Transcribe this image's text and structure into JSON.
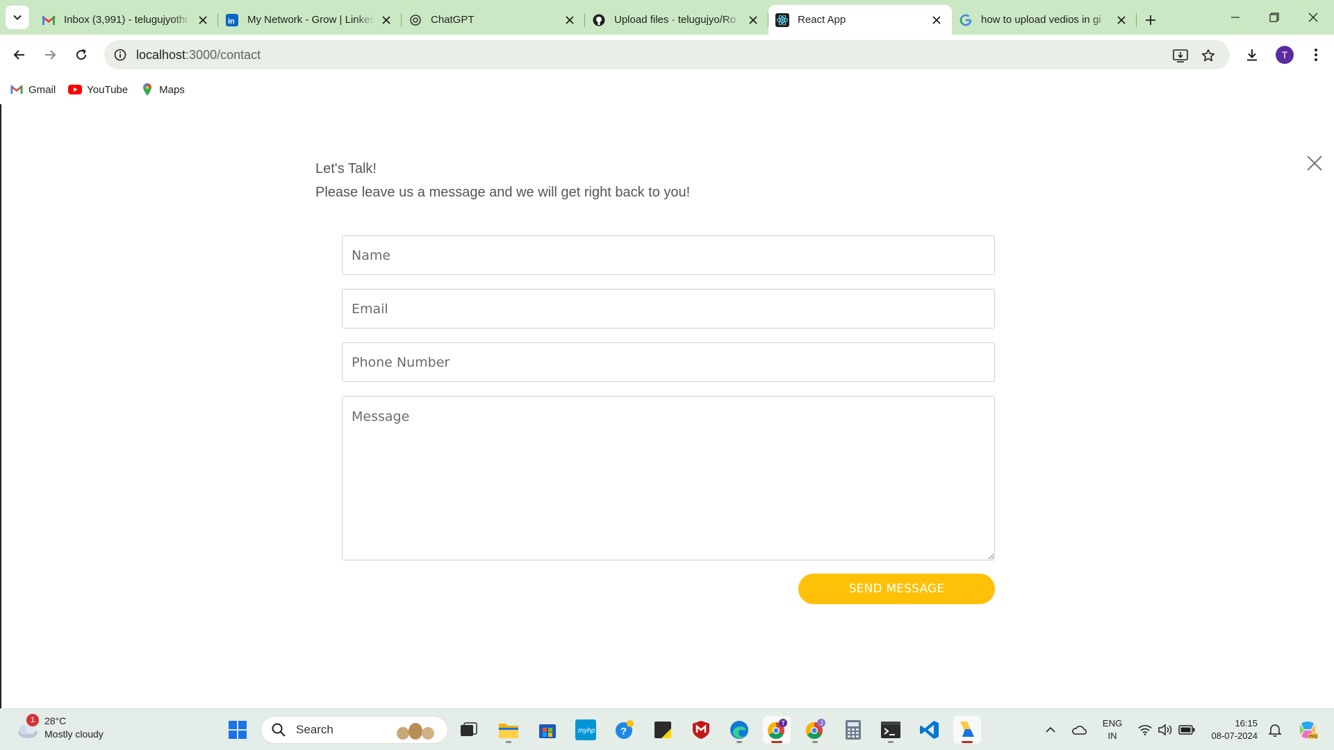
{
  "browser": {
    "tabs": [
      {
        "title": "Inbox (3,991) - telugujyothi",
        "icon": "gmail-icon"
      },
      {
        "title": "My Network - Grow | LinkedIn",
        "icon": "linkedin-icon"
      },
      {
        "title": "ChatGPT",
        "icon": "chatgpt-icon"
      },
      {
        "title": "Upload files · telugujyo/Ro",
        "icon": "github-icon"
      },
      {
        "title": "React App",
        "icon": "react-icon",
        "active": true
      },
      {
        "title": "how to upload vedios in gi",
        "icon": "google-icon"
      }
    ],
    "url_host": "localhost",
    "url_path": ":3000/contact",
    "profile_initial": "T"
  },
  "bookmarks": [
    {
      "label": "Gmail",
      "icon": "gmail-icon"
    },
    {
      "label": "YouTube",
      "icon": "youtube-icon"
    },
    {
      "label": "Maps",
      "icon": "maps-pin-icon"
    }
  ],
  "contact": {
    "heading": "Let's Talk!",
    "subheading": "Please leave us a message and we will get right back to you!",
    "name_placeholder": "Name",
    "email_placeholder": "Email",
    "phone_placeholder": "Phone Number",
    "message_placeholder": "Message",
    "send_label": "SEND MESSAGE",
    "accent_color": "#ffc107"
  },
  "taskbar": {
    "weather_badge": "1",
    "temperature": "28°C",
    "condition": "Mostly cloudy",
    "search_label": "Search",
    "lang_primary": "ENG",
    "lang_secondary": "IN",
    "time": "16:15",
    "date": "08-07-2024"
  }
}
